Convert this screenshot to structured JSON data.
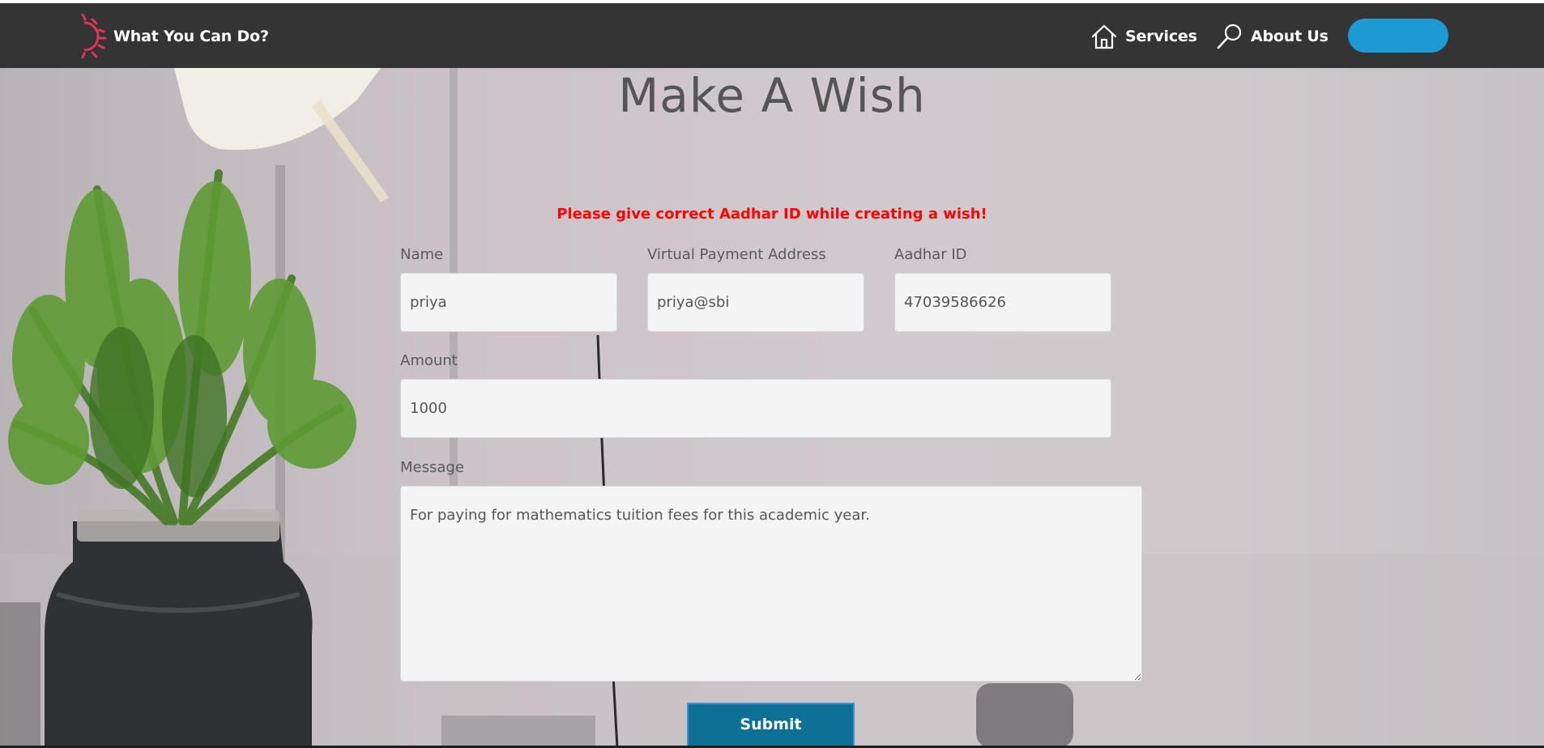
{
  "navbar": {
    "brand": "What You Can Do?",
    "links": [
      {
        "label": "Services",
        "icon": "home-icon"
      },
      {
        "label": "About Us",
        "icon": "search-icon"
      }
    ],
    "pill_button_color": "#1b9ad4",
    "background_color": "#343434"
  },
  "page": {
    "title": "Make A Wish",
    "warning": "Please give correct Aadhar ID while creating a wish!",
    "warning_color": "#ff0000"
  },
  "form": {
    "name": {
      "label": "Name",
      "value": "priya"
    },
    "vpa": {
      "label": "Virtual Payment Address",
      "value": "priya@sbi"
    },
    "aadhar": {
      "label": "Aadhar ID",
      "value": "47039586626"
    },
    "amount": {
      "label": "Amount",
      "value": "1000"
    },
    "message": {
      "label": "Message",
      "value": "For paying for mathematics tuition fees for this academic year."
    },
    "submit_label": "Submit"
  }
}
